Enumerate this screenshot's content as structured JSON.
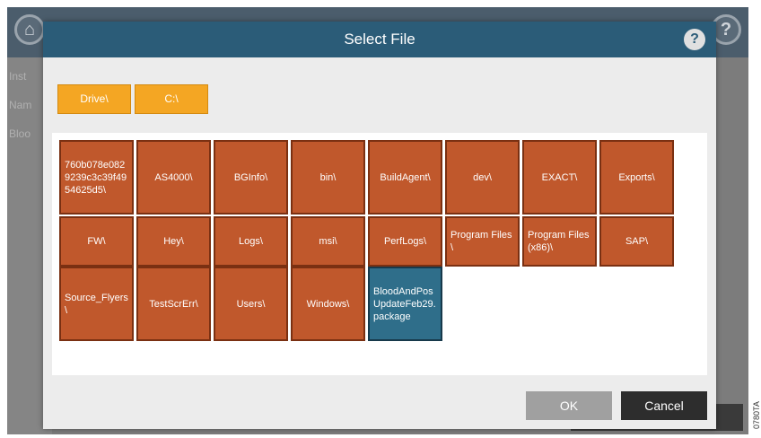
{
  "background": {
    "labels": [
      "Inst",
      "Nam",
      "Bloo"
    ],
    "home_icon": "home-icon",
    "help_icon": "help-icon"
  },
  "dialog": {
    "title": "Select File",
    "help_label": "?",
    "breadcrumbs": [
      "Drive\\",
      "C:\\"
    ],
    "items": [
      {
        "label": "760b078e0829239c3c39f4954625d5\\",
        "type": "folder"
      },
      {
        "label": "AS4000\\",
        "type": "folder"
      },
      {
        "label": "BGInfo\\",
        "type": "folder"
      },
      {
        "label": "bin\\",
        "type": "folder"
      },
      {
        "label": "BuildAgent\\",
        "type": "folder"
      },
      {
        "label": "dev\\",
        "type": "folder"
      },
      {
        "label": "EXACT\\",
        "type": "folder"
      },
      {
        "label": "Exports\\",
        "type": "folder"
      },
      {
        "label": "FW\\",
        "type": "folder"
      },
      {
        "label": "Hey\\",
        "type": "folder"
      },
      {
        "label": "Logs\\",
        "type": "folder"
      },
      {
        "label": "msi\\",
        "type": "folder"
      },
      {
        "label": "PerfLogs\\",
        "type": "folder"
      },
      {
        "label": "Program Files\\",
        "type": "folder"
      },
      {
        "label": "Program Files (x86)\\",
        "type": "folder"
      },
      {
        "label": "SAP\\",
        "type": "folder"
      },
      {
        "label": "Source_Flyers\\",
        "type": "folder"
      },
      {
        "label": "TestScrErr\\",
        "type": "folder"
      },
      {
        "label": "Users\\",
        "type": "folder"
      },
      {
        "label": "Windows\\",
        "type": "folder"
      },
      {
        "label": "BloodAndPosUpdateFeb29.package",
        "type": "file"
      }
    ],
    "ok_label": "OK",
    "cancel_label": "Cancel"
  },
  "figure_code": "0780TA",
  "colors": {
    "title_bar": "#2b5c78",
    "breadcrumb": "#f4a623",
    "folder": "#c0582c",
    "file": "#2f6e8a",
    "ok_disabled": "#a0a0a0",
    "cancel": "#2d2d2d"
  }
}
